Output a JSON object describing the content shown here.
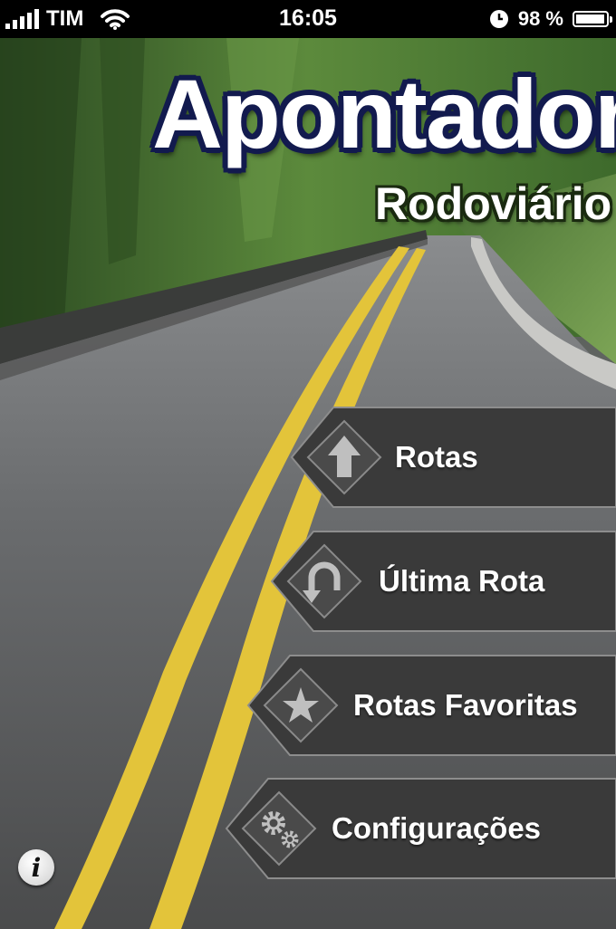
{
  "status_bar": {
    "carrier": "TIM",
    "time": "16:05",
    "battery": "98 %",
    "battery_level": 0.98
  },
  "logo": {
    "title": "Apontador",
    "subtitle": "Rodoviário"
  },
  "menu": {
    "items": [
      {
        "label": "Rotas",
        "icon": "arrow-up-icon"
      },
      {
        "label": "Última Rota",
        "icon": "u-turn-icon"
      },
      {
        "label": "Rotas Favoritas",
        "icon": "star-icon"
      },
      {
        "label": "Configurações",
        "icon": "gears-icon"
      }
    ]
  },
  "info_button": {
    "glyph": "i"
  },
  "colors": {
    "logo_outline": "#121a4e",
    "button_fill": "#3a3a3a",
    "road_line": "#e3c43a"
  }
}
